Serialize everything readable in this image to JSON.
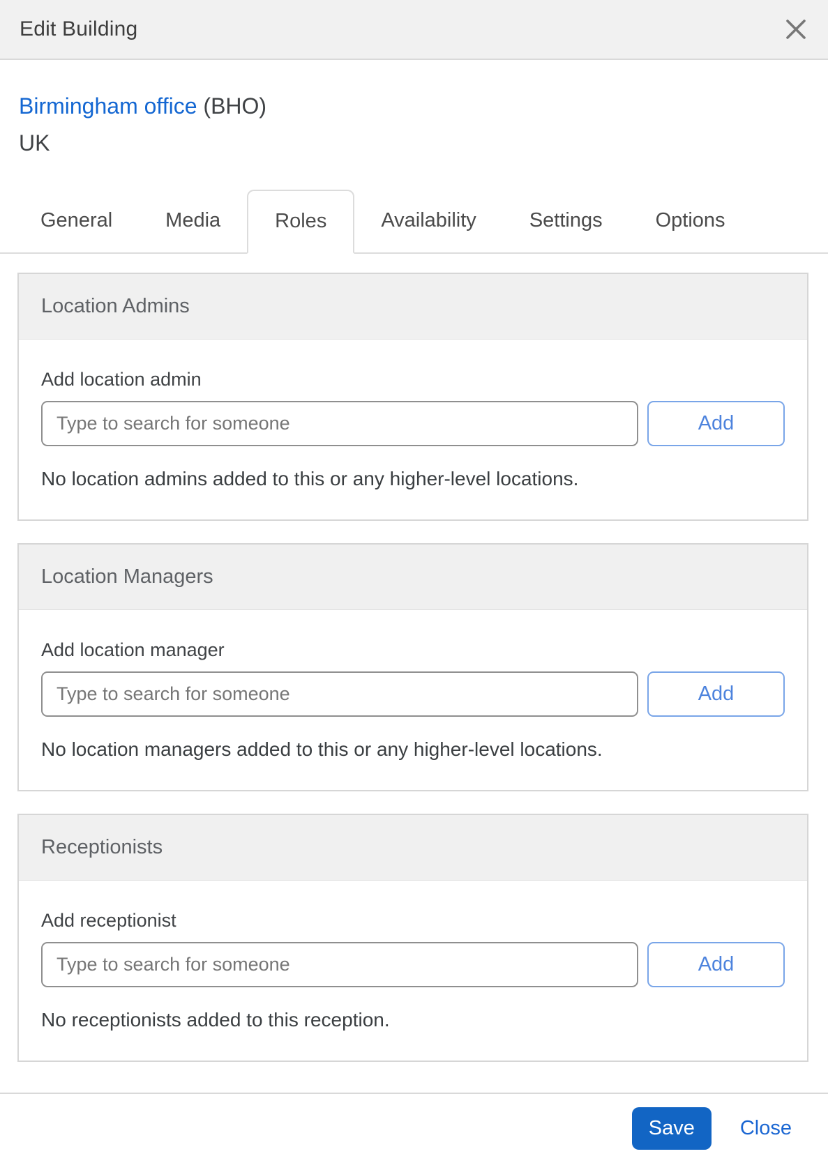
{
  "dialog": {
    "title": "Edit Building",
    "building": {
      "name": "Birmingham office",
      "code": "(BHO)",
      "country": "UK"
    },
    "tabs": [
      {
        "label": "General",
        "active": false
      },
      {
        "label": "Media",
        "active": false
      },
      {
        "label": "Roles",
        "active": true
      },
      {
        "label": "Availability",
        "active": false
      },
      {
        "label": "Settings",
        "active": false
      },
      {
        "label": "Options",
        "active": false
      }
    ],
    "sections": [
      {
        "title": "Location Admins",
        "label": "Add location admin",
        "placeholder": "Type to search for someone",
        "input_value": "",
        "add_label": "Add",
        "empty_text": "No location admins added to this or any higher-level locations."
      },
      {
        "title": "Location Managers",
        "label": "Add location manager",
        "placeholder": "Type to search for someone",
        "input_value": "",
        "add_label": "Add",
        "empty_text": "No location managers added to this or any higher-level locations."
      },
      {
        "title": "Receptionists",
        "label": "Add receptionist",
        "placeholder": "Type to search for someone",
        "input_value": "",
        "add_label": "Add",
        "empty_text": "No receptionists added to this reception."
      }
    ],
    "footer": {
      "save_label": "Save",
      "close_label": "Close"
    },
    "icons": {
      "close": "close-icon"
    },
    "colors": {
      "header_bg": "#f1f1f1",
      "panel_header_bg": "#f0f0f0",
      "border_gray": "#d9d9d9",
      "link_blue": "#1467d2",
      "add_button_blue": "#4d83dd",
      "save_button_bg": "#1265c4",
      "close_link_blue": "#1a66d2",
      "placeholder_gray": "#767676"
    }
  }
}
